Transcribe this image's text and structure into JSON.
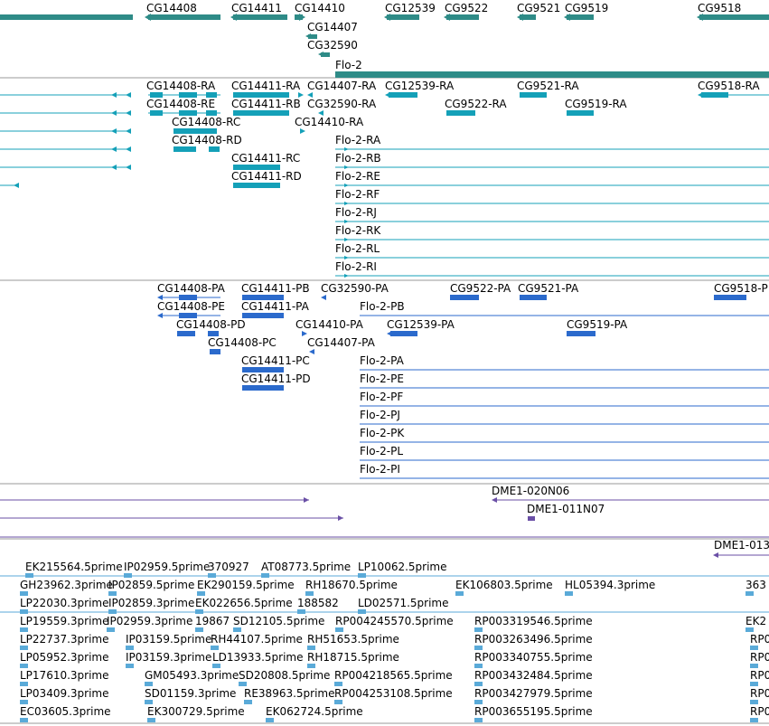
{
  "colors": {
    "gene": "#2e8b87",
    "transcript": "#14a0b8",
    "protein": "#2b6acc",
    "clone": "#6a4fa6",
    "est": "#5aaad8",
    "separator": "#999999"
  },
  "genes": [
    {
      "label": "CG14408",
      "id": "gene-CG14408"
    },
    {
      "label": "CG14411",
      "id": "gene-CG14411"
    },
    {
      "label": "CG14410",
      "id": "gene-CG14410"
    },
    {
      "label": "CG12539",
      "id": "gene-CG12539"
    },
    {
      "label": "CG9522",
      "id": "gene-CG9522"
    },
    {
      "label": "CG9521",
      "id": "gene-CG9521"
    },
    {
      "label": "CG9519",
      "id": "gene-CG9519"
    },
    {
      "label": "CG9518",
      "id": "gene-CG9518"
    },
    {
      "label": "CG14407",
      "id": "gene-CG14407"
    },
    {
      "label": "CG32590",
      "id": "gene-CG32590"
    },
    {
      "label": "Flo-2",
      "id": "gene-Flo-2"
    }
  ],
  "transcripts": [
    {
      "label": "CG14408-RA"
    },
    {
      "label": "CG14411-RA"
    },
    {
      "label": "CG14407-RA"
    },
    {
      "label": "CG12539-RA"
    },
    {
      "label": "CG9521-RA"
    },
    {
      "label": "CG9518-RA"
    },
    {
      "label": "CG14408-RE"
    },
    {
      "label": "CG14411-RB"
    },
    {
      "label": "CG32590-RA"
    },
    {
      "label": "CG9522-RA"
    },
    {
      "label": "CG9519-RA"
    },
    {
      "label": "CG14408-RC"
    },
    {
      "label": "CG14410-RA"
    },
    {
      "label": "CG14408-RD"
    },
    {
      "label": "Flo-2-RA"
    },
    {
      "label": "CG14411-RC"
    },
    {
      "label": "Flo-2-RB"
    },
    {
      "label": "CG14411-RD"
    },
    {
      "label": "Flo-2-RE"
    },
    {
      "label": "Flo-2-RF"
    },
    {
      "label": "Flo-2-RJ"
    },
    {
      "label": "Flo-2-RK"
    },
    {
      "label": "Flo-2-RL"
    },
    {
      "label": "Flo-2-RI"
    }
  ],
  "proteins": [
    {
      "label": "CG14408-PA"
    },
    {
      "label": "CG14411-PB"
    },
    {
      "label": "CG32590-PA"
    },
    {
      "label": "CG9522-PA"
    },
    {
      "label": "CG9521-PA"
    },
    {
      "label": "CG9518-P"
    },
    {
      "label": "CG14408-PE"
    },
    {
      "label": "CG14411-PA"
    },
    {
      "label": "Flo-2-PB"
    },
    {
      "label": "CG14408-PD"
    },
    {
      "label": "CG14410-PA"
    },
    {
      "label": "CG12539-PA"
    },
    {
      "label": "CG9519-PA"
    },
    {
      "label": "CG14408-PC"
    },
    {
      "label": "CG14407-PA"
    },
    {
      "label": "CG14411-PC"
    },
    {
      "label": "Flo-2-PA"
    },
    {
      "label": "CG14411-PD"
    },
    {
      "label": "Flo-2-PE"
    },
    {
      "label": "Flo-2-PF"
    },
    {
      "label": "Flo-2-PJ"
    },
    {
      "label": "Flo-2-PK"
    },
    {
      "label": "Flo-2-PL"
    },
    {
      "label": "Flo-2-PI"
    }
  ],
  "clones": [
    {
      "label": "DME1-020N06"
    },
    {
      "label": "DME1-011N07"
    },
    {
      "label": "DME1-013"
    }
  ],
  "ests": [
    {
      "label": "EK215564.5prime"
    },
    {
      "label": "IP02959.5prime"
    },
    {
      "label": "370927"
    },
    {
      "label": "AT08773.5prime"
    },
    {
      "label": "LP10062.5prime"
    },
    {
      "label": "GH23962.3prime"
    },
    {
      "label": "IP02859.5prime"
    },
    {
      "label": "EK290159.5prime"
    },
    {
      "label": "RH18670.5prime"
    },
    {
      "label": "EK106803.5prime"
    },
    {
      "label": "HL05394.3prime"
    },
    {
      "label": "363"
    },
    {
      "label": "LP22030.3prime"
    },
    {
      "label": "IP02859.3prime"
    },
    {
      "label": "EK022656.5prime"
    },
    {
      "label": "188582"
    },
    {
      "label": "LD02571.5prime"
    },
    {
      "label": "LP19559.3prime"
    },
    {
      "label": "IP02959.3prime"
    },
    {
      "label": "19867"
    },
    {
      "label": "SD12105.5prime"
    },
    {
      "label": "RP004245570.5prime"
    },
    {
      "label": "RP003319546.5prime"
    },
    {
      "label": "EK2"
    },
    {
      "label": "LP22737.3prime"
    },
    {
      "label": "IP03159.5prime"
    },
    {
      "label": "RH44107.5prime"
    },
    {
      "label": "RH51653.5prime"
    },
    {
      "label": "RP003263496.5prime"
    },
    {
      "label": "RP0"
    },
    {
      "label": "LP05952.3prime"
    },
    {
      "label": "IP03159.3prime"
    },
    {
      "label": "LD13933.5prime"
    },
    {
      "label": "RH18715.5prime"
    },
    {
      "label": "RP003340755.5prime"
    },
    {
      "label": "RP0"
    },
    {
      "label": "LP17610.3prime"
    },
    {
      "label": "GM05493.3prime"
    },
    {
      "label": "SD20808.5prime"
    },
    {
      "label": "RP004218565.5prime"
    },
    {
      "label": "RP003432484.5prime"
    },
    {
      "label": "RP0"
    },
    {
      "label": "LP03409.3prime"
    },
    {
      "label": "SD01159.3prime"
    },
    {
      "label": "RE38963.5prime"
    },
    {
      "label": "RP004253108.5prime"
    },
    {
      "label": "RP003427979.5prime"
    },
    {
      "label": "RP0"
    },
    {
      "label": "EC03605.3prime"
    },
    {
      "label": "EK300729.5prime"
    },
    {
      "label": "EK062724.5prime"
    },
    {
      "label": "RP003655195.5prime"
    },
    {
      "label": "RP0"
    }
  ]
}
